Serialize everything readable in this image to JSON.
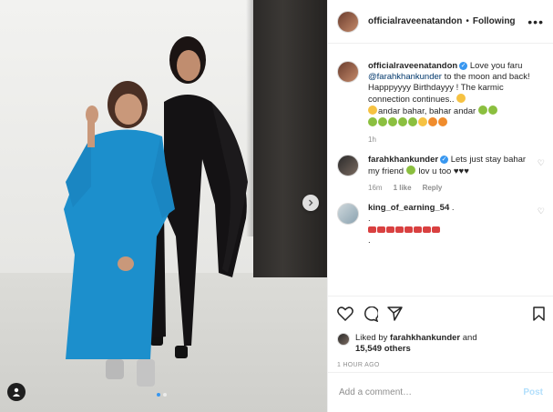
{
  "post": {
    "author": "officialraveenatandon",
    "follow_separator": "•",
    "follow_state": "Following",
    "more_icon": "more-horizontal-icon"
  },
  "caption": {
    "author": "officialraveenatandon",
    "text_before": "Love you faru ",
    "mention": "@farahkhankunder",
    "text_after": " to the moon and back! Happpyyyy Birthdayyy ! The karmic connection continues..",
    "line2": "andar bahar, bahar andar",
    "time": "1h"
  },
  "comments": [
    {
      "author": "farahkhankunder",
      "text": "Lets just stay bahar my friend",
      "text_end": " lov u too ♥♥♥",
      "time": "16m",
      "likes": "1 like",
      "reply": "Reply"
    },
    {
      "author": "king_of_earning_54",
      "text": ".",
      "line2": ".",
      "line3": "."
    }
  ],
  "likes": {
    "prefix": "Liked by ",
    "user": "farahkhankunder",
    "mid": " and",
    "count": "15,549 others"
  },
  "time_ago": "1 HOUR AGO",
  "add_comment": {
    "placeholder": "Add a comment…",
    "post_label": "Post"
  },
  "colors": {
    "accent": "#3897f0",
    "post_disabled": "#b2dffc",
    "meta_gray": "#8e8e8e"
  }
}
